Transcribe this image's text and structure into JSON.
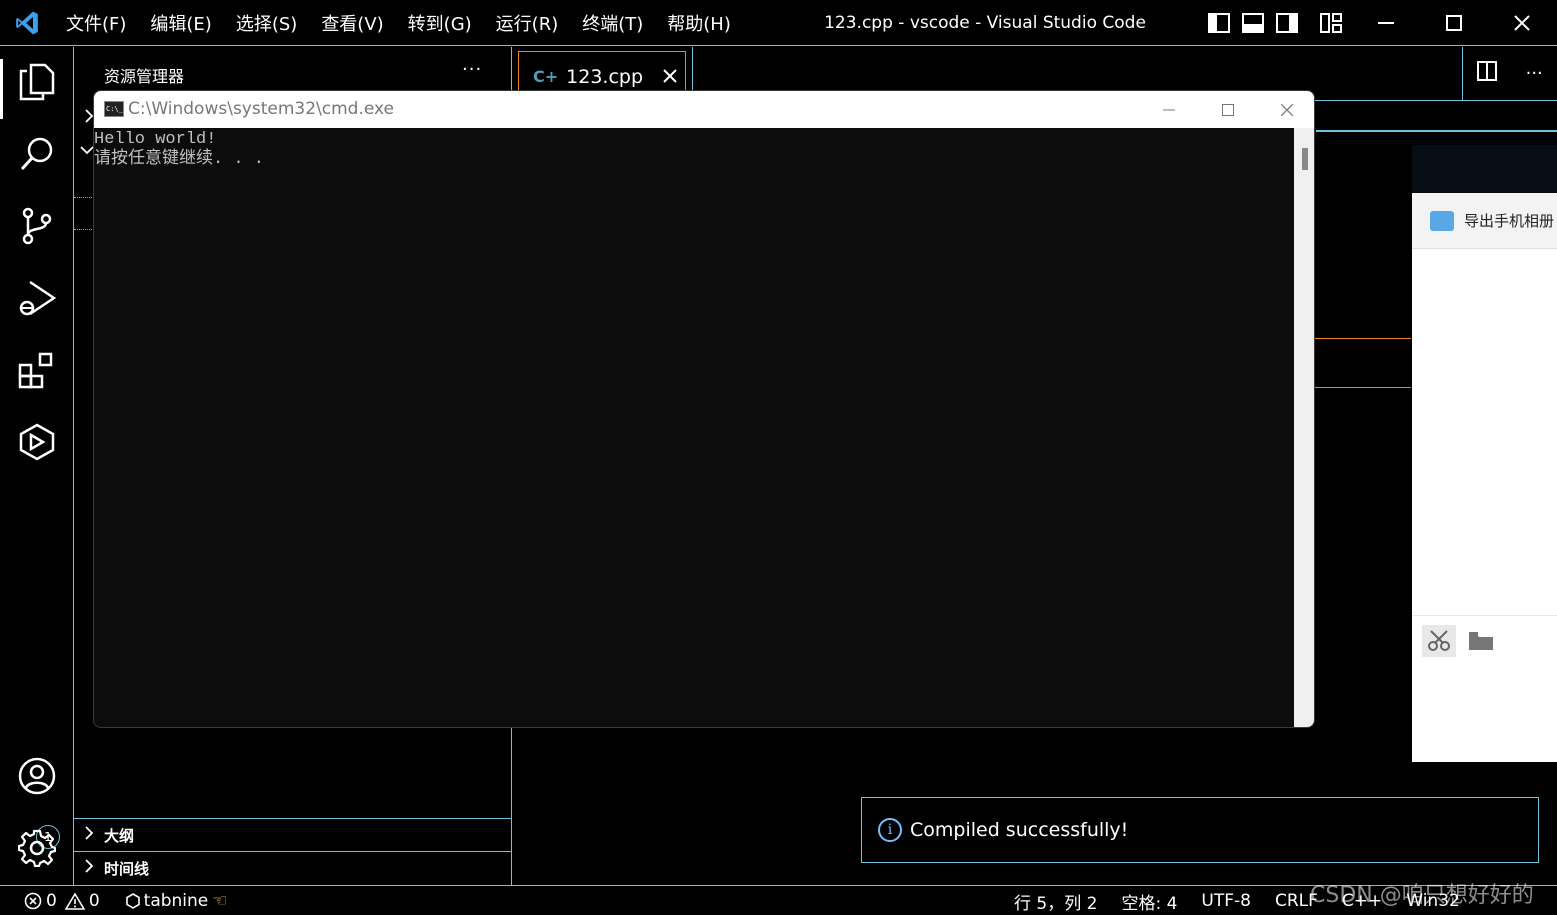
{
  "menu": {
    "items": [
      "文件(F)",
      "编辑(E)",
      "选择(S)",
      "查看(V)",
      "转到(G)",
      "运行(R)",
      "终端(T)",
      "帮助(H)"
    ]
  },
  "window": {
    "title": "123.cpp - vscode - Visual Studio Code"
  },
  "activity": {
    "accounts_badge": "1"
  },
  "sidebar": {
    "title": "资源管理器",
    "more": "···",
    "sections": [
      {
        "label": "大纲"
      },
      {
        "label": "时间线"
      }
    ]
  },
  "editor": {
    "tab": {
      "label": "123.cpp",
      "icon": "C+"
    }
  },
  "cmd": {
    "title": "C:\\Windows\\system32\\cmd.exe",
    "icon_text": "C:\\_",
    "lines": [
      "Hello world!",
      "请按任意键继续. . ."
    ]
  },
  "float_panel": {
    "row_label": "导出手机相册"
  },
  "notification": {
    "message": "Compiled successfully!"
  },
  "status": {
    "errors": "0",
    "warnings": "0",
    "tabnine": "tabnine",
    "position": "行 5，列 2",
    "spaces": "空格: 4",
    "encoding": "UTF-8",
    "eol": "CRLF",
    "language": "C++",
    "config": "Win32"
  },
  "watermark": "CSDN @咱只想好好的",
  "colors": {
    "contrast_border": "#6fc3df",
    "active_border": "#f38518",
    "info": "#75beff"
  }
}
